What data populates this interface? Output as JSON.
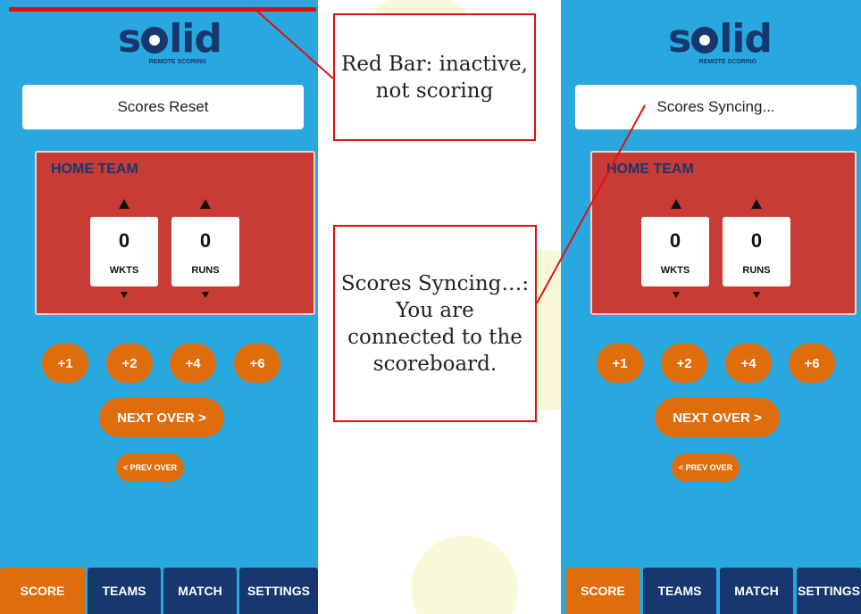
{
  "colors": {
    "screen_bg": "#29a8e0",
    "accent_orange": "#e06d0c",
    "navy": "#16386e",
    "team_red": "#c83c35",
    "annotation_red": "#e01010"
  },
  "logo": {
    "word": "solid",
    "tagline": "REMOTE SCORING"
  },
  "left_screen": {
    "status": "Scores Reset",
    "team": "HOME TEAM",
    "wickets": {
      "value": "0",
      "label": "WKTS"
    },
    "runs": {
      "value": "0",
      "label": "RUNS"
    },
    "run_buttons": [
      "+1",
      "+2",
      "+4",
      "+6"
    ],
    "next_over": "NEXT OVER >",
    "prev_over": "< PREV OVER",
    "tabs": [
      {
        "label": "SCORE",
        "active": true
      },
      {
        "label": "TEAMS",
        "active": false
      },
      {
        "label": "MATCH",
        "active": false
      },
      {
        "label": "SETTINGS",
        "active": false
      }
    ]
  },
  "right_screen": {
    "status": "Scores Syncing...",
    "team": "HOME TEAM",
    "wickets": {
      "value": "0",
      "label": "WKTS"
    },
    "runs": {
      "value": "0",
      "label": "RUNS"
    },
    "run_buttons": [
      "+1",
      "+2",
      "+4",
      "+6"
    ],
    "next_over": "NEXT OVER >",
    "prev_over": "< PREV OVER",
    "tabs": [
      {
        "label": "SCORE",
        "active": true
      },
      {
        "label": "TEAMS",
        "active": false
      },
      {
        "label": "MATCH",
        "active": false
      },
      {
        "label": "SETTINGS",
        "active": false
      }
    ]
  },
  "annotations": {
    "red_bar": "Red Bar: inactive, not scoring",
    "syncing": "Scores Syncing…: You are connected to the scoreboard."
  }
}
